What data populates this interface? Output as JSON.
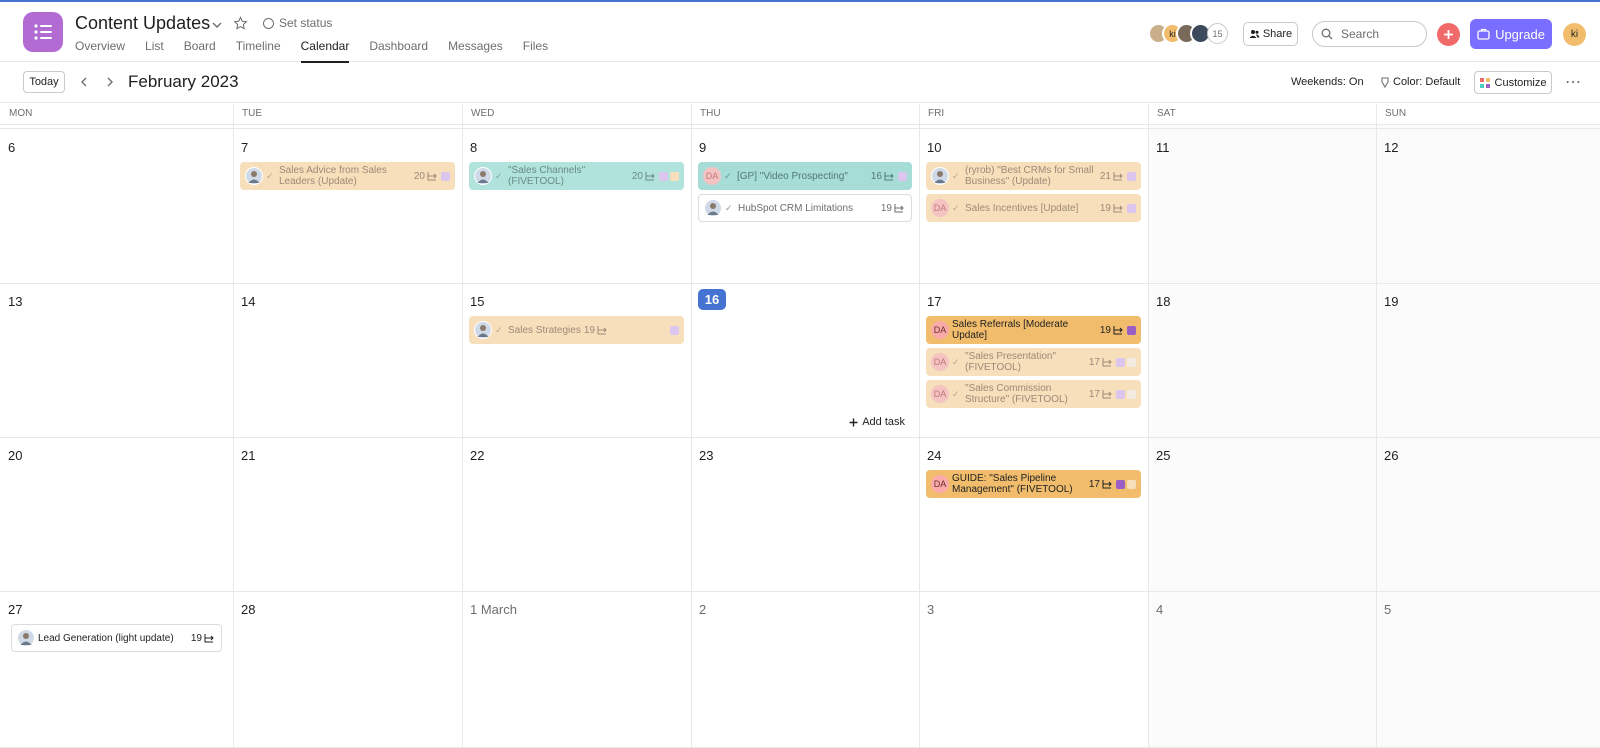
{
  "header": {
    "title": "Content Updates",
    "set_status": "Set status",
    "tabs": [
      {
        "label": "Overview"
      },
      {
        "label": "List"
      },
      {
        "label": "Board"
      },
      {
        "label": "Timeline"
      },
      {
        "label": "Calendar"
      },
      {
        "label": "Dashboard"
      },
      {
        "label": "Messages"
      },
      {
        "label": "Files"
      }
    ],
    "active_tab": "Calendar",
    "members": [
      {
        "initials": "",
        "color": "#c9b08a"
      },
      {
        "initials": "ki",
        "color": "#f1bd6c"
      },
      {
        "initials": "",
        "color": "#7a6a5a"
      },
      {
        "initials": "",
        "color": "#3d4a5c"
      }
    ],
    "member_count": "15",
    "share_label": "Share",
    "search_placeholder": "Search",
    "upgrade_label": "Upgrade",
    "user_initials": "ki"
  },
  "toolbar": {
    "today_label": "Today",
    "month": "February 2023",
    "weekends": "Weekends: On",
    "color": "Color: Default",
    "customize": "Customize"
  },
  "weekdays": [
    "MON",
    "TUE",
    "WED",
    "THU",
    "FRI",
    "SAT",
    "SUN"
  ],
  "weeks": [
    {
      "days": [
        {
          "label": "6"
        },
        {
          "label": "7",
          "tasks": [
            {
              "name": "Sales Advice from Sales Leaders (Update)",
              "count": "20",
              "style": "light",
              "avatar": "photo",
              "check": true,
              "squares": [
                "#dcc6f0"
              ]
            }
          ]
        },
        {
          "label": "8",
          "tasks": [
            {
              "name": "\"Sales Channels\" (FIVETOOL)",
              "count": "20",
              "style": "teal",
              "avatar": "photo",
              "check": true,
              "squares": [
                "#dcc6f0",
                "#f8dfbb"
              ]
            }
          ]
        },
        {
          "label": "9",
          "tasks": [
            {
              "name": "[GP] \"Video Prospecting\"",
              "count": "16",
              "style": "teal-strong",
              "avatar": "da-light",
              "check": true,
              "squares": [
                "#dcc6f0"
              ]
            },
            {
              "name": "HubSpot CRM Limitations",
              "count": "19",
              "style": "white",
              "avatar": "photo",
              "check": true,
              "squares": []
            }
          ]
        },
        {
          "label": "10",
          "tasks": [
            {
              "name": "(ryrob) \"Best CRMs for Small Business\" (Update)",
              "count": "21",
              "style": "light",
              "avatar": "photo",
              "check": true,
              "squares": [
                "#dcc6f0"
              ]
            },
            {
              "name": "Sales Incentives [Update]",
              "count": "19",
              "style": "light",
              "avatar": "da-light",
              "check": true,
              "squares": [
                "#dcc6f0"
              ]
            }
          ]
        },
        {
          "label": "11"
        },
        {
          "label": "12"
        }
      ]
    },
    {
      "days": [
        {
          "label": "13"
        },
        {
          "label": "14"
        },
        {
          "label": "15",
          "tasks": [
            {
              "name": "Sales Strategies",
              "count": "19",
              "style": "light",
              "avatar": "photo",
              "check": true,
              "squares": [
                "#dcc6f0"
              ],
              "spacer": true
            }
          ]
        },
        {
          "label": "16",
          "today": true,
          "add_task": "Add task"
        },
        {
          "label": "17",
          "tasks": [
            {
              "name": "Sales Referrals [Moderate Update]",
              "count": "19",
              "style": "orange",
              "avatar": "da",
              "check": false,
              "squares": [
                "#9a5fc4"
              ]
            },
            {
              "name": "\"Sales Presentation\" (FIVETOOL)",
              "count": "17",
              "style": "light",
              "avatar": "da-light",
              "check": true,
              "squares": [
                "#dcc6f0",
                "#f4ebe0"
              ]
            },
            {
              "name": "\"Sales Commission Structure\" (FIVETOOL)",
              "count": "17",
              "style": "light",
              "avatar": "da-light",
              "check": true,
              "squares": [
                "#dcc6f0",
                "#f4ebe0"
              ]
            }
          ]
        },
        {
          "label": "18"
        },
        {
          "label": "19"
        }
      ]
    },
    {
      "days": [
        {
          "label": "20"
        },
        {
          "label": "21"
        },
        {
          "label": "22"
        },
        {
          "label": "23"
        },
        {
          "label": "24",
          "tasks": [
            {
              "name": "GUIDE: \"Sales Pipeline Management\" (FIVETOOL)",
              "count": "17",
              "style": "orange",
              "avatar": "da",
              "check": false,
              "squares": [
                "#9a5fc4",
                "#f8dfbb"
              ]
            }
          ]
        },
        {
          "label": "25"
        },
        {
          "label": "26"
        }
      ]
    },
    {
      "days": [
        {
          "label": "27",
          "tasks": [
            {
              "name": "Lead Generation (light update)",
              "count": "19",
              "style": "white-strong",
              "avatar": "photo",
              "check": false,
              "squares": []
            }
          ]
        },
        {
          "label": "28"
        },
        {
          "label": "1 March",
          "other": true
        },
        {
          "label": "2",
          "other": true
        },
        {
          "label": "3",
          "other": true
        },
        {
          "label": "4",
          "other": true
        },
        {
          "label": "5",
          "other": true
        }
      ]
    }
  ]
}
